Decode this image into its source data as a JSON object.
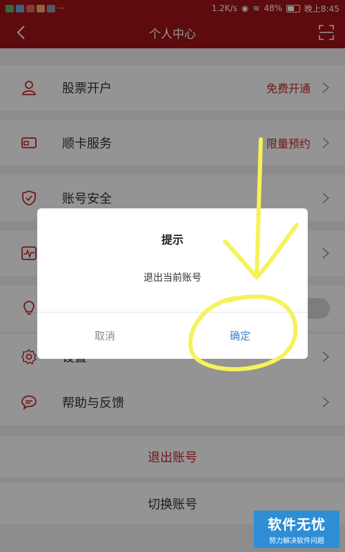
{
  "status_bar": {
    "speed": "1.2K/s",
    "battery": "48%",
    "time": "晚上8:45"
  },
  "header": {
    "title": "个人中心"
  },
  "menu": {
    "items": [
      {
        "label": "股票开户",
        "value": "免费开通",
        "icon": "person-icon"
      },
      {
        "label": "顺卡服务",
        "value": "限量预约",
        "icon": "card-icon"
      },
      {
        "label": "账号安全",
        "value": "",
        "icon": "shield-icon"
      },
      {
        "label": "",
        "value": "",
        "icon": "activity-icon"
      },
      {
        "label": "",
        "value": "",
        "icon": "lightbulb-icon"
      },
      {
        "label": "设置",
        "value": "",
        "icon": "gear-icon"
      },
      {
        "label": "帮助与反馈",
        "value": "",
        "icon": "chat-icon"
      }
    ],
    "logout_label": "退出账号",
    "switch_label": "切换账号"
  },
  "dialog": {
    "title": "提示",
    "message": "退出当前账号",
    "cancel_label": "取消",
    "ok_label": "确定"
  },
  "annotation": {
    "color": "#f6f25a"
  },
  "watermark": {
    "title": "软件无忧",
    "subtitle": "努力解决软件问题"
  },
  "colors": {
    "brand": "#a01416",
    "accent_red": "#c5262c",
    "dialog_ok": "#3f7fd0"
  }
}
